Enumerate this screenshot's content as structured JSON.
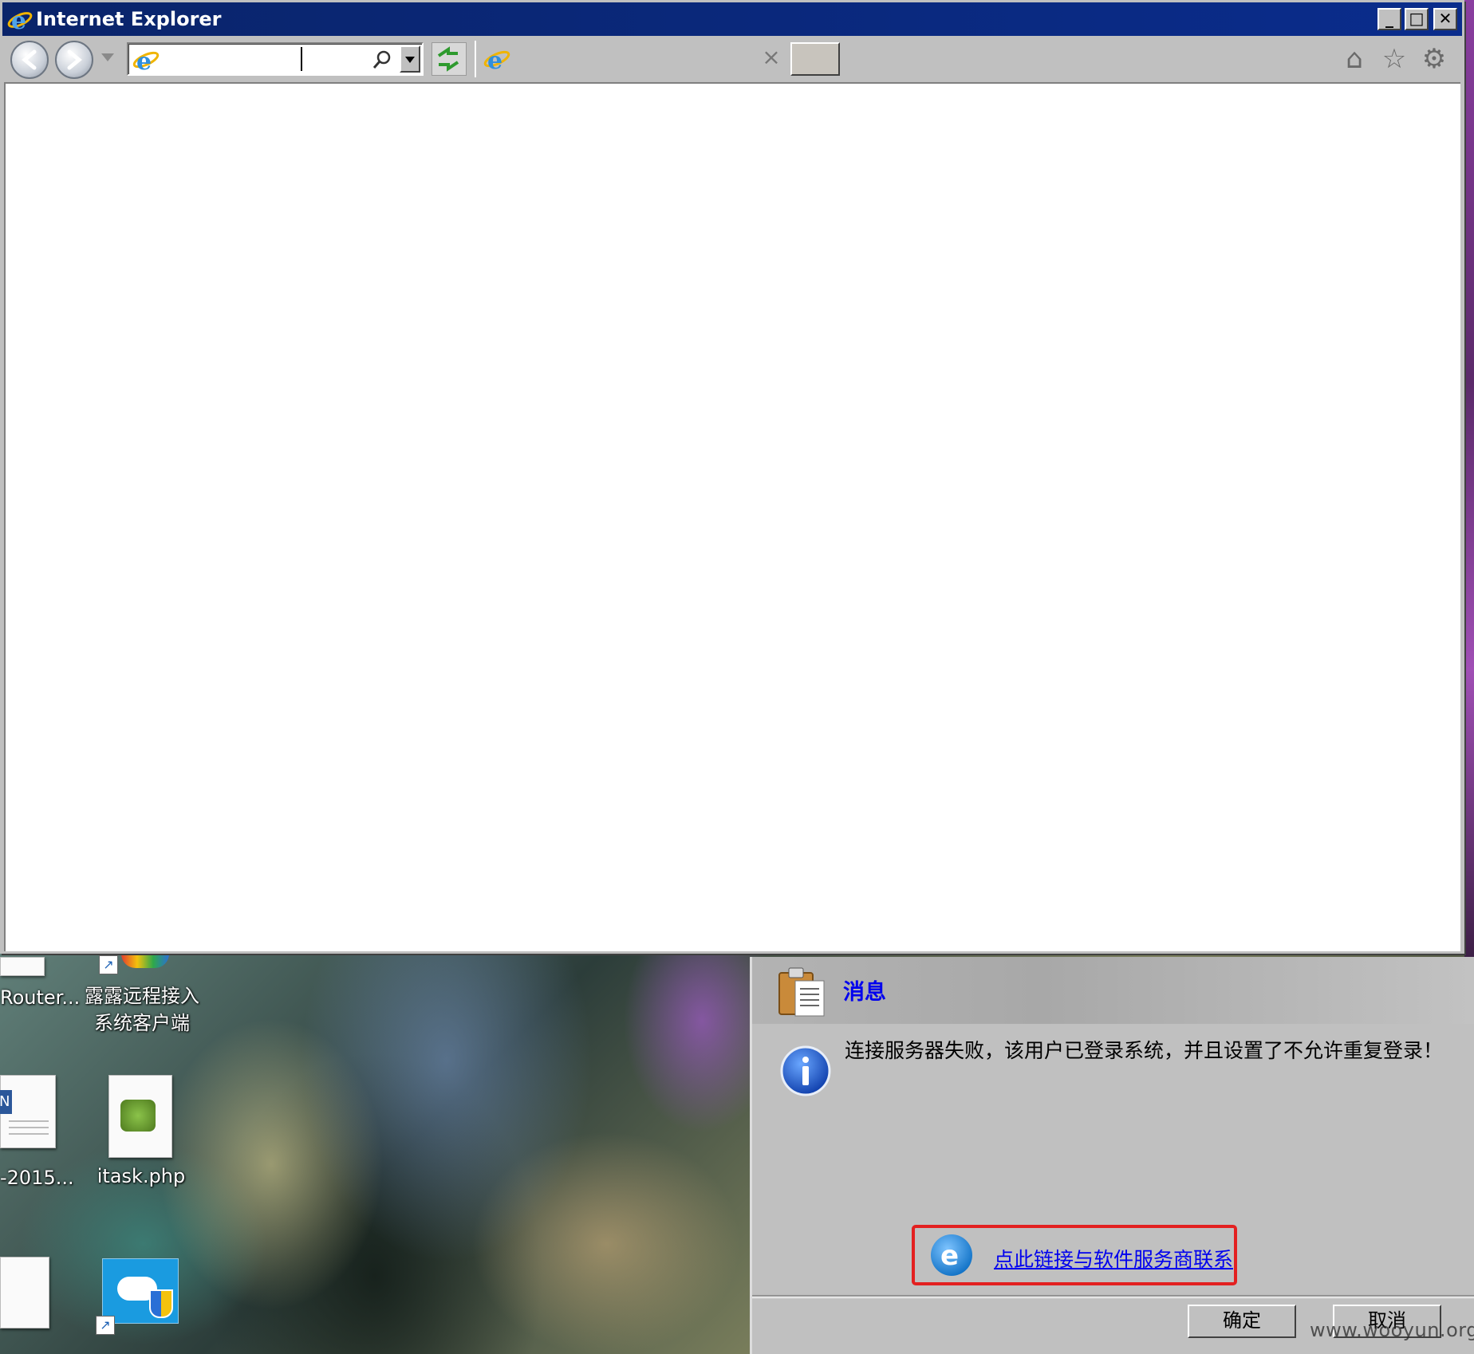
{
  "window": {
    "title": "Internet Explorer",
    "minimize_label": "_",
    "maximize_label": "□",
    "close_label": "✕"
  },
  "address_bar": {
    "value": "",
    "placeholder": ""
  },
  "tab": {
    "title": "",
    "close_label": "×"
  },
  "desktop": {
    "icons": [
      {
        "label": "Router..."
      },
      {
        "label": "露露远程接入系统客户端"
      },
      {
        "label": "-2015..."
      },
      {
        "label": "itask.php"
      }
    ]
  },
  "dialog": {
    "title": "消息",
    "message": "连接服务器失败，该用户已登录系统，并且设置了不允许重复登录！",
    "link_text": "点此链接与软件服务商联系",
    "ok_label": "确定",
    "cancel_label": "取消"
  },
  "watermark": "www.wooyun.org",
  "colors": {
    "title_bar": "#0a246a",
    "link": "#0000ee",
    "highlight_border": "#e32020",
    "chrome": "#c0c0c0"
  }
}
